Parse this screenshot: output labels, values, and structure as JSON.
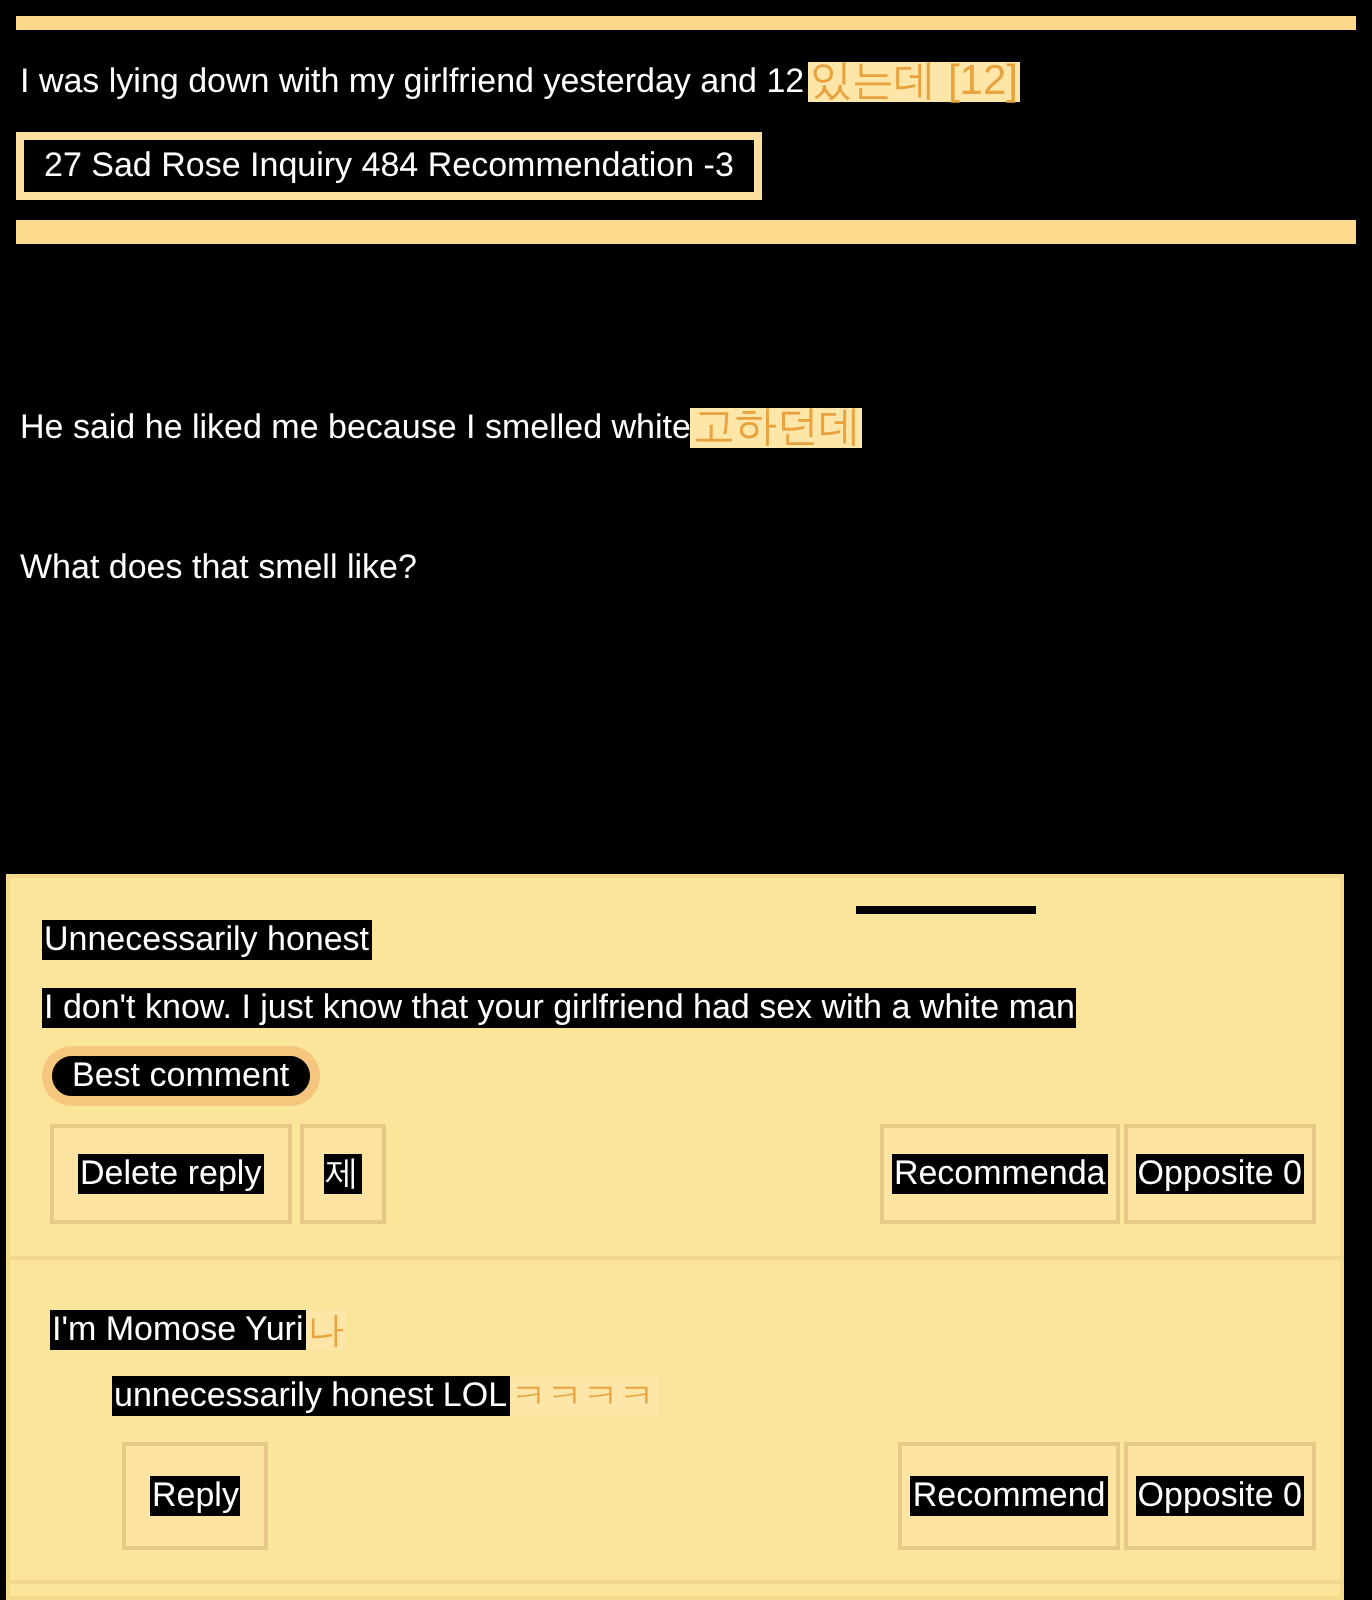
{
  "post": {
    "title": "I was lying down with my girlfriend yesterday and 12",
    "title_trailing": "있는데 [12]",
    "meta": "27 Sad Rose Inquiry 484 Recommendation -3",
    "body": [
      {
        "text": "He said he liked me because I smelled white",
        "trailing": "고하던데"
      },
      {
        "text": "What does that smell like?"
      }
    ]
  },
  "comments": [
    {
      "kind": "comment",
      "author": "Unnecessarily honest",
      "text": "I don't know. I just know that your girlfriend had sex with a white man",
      "badge": "Best comment",
      "actions": [
        "Delete reply",
        "제"
      ],
      "votes": [
        "Recommenda",
        "Opposite 0"
      ]
    },
    {
      "kind": "reply",
      "author": "I'm Momose Yuri",
      "author_trailing": "나",
      "text": "unnecessarily honest LOL",
      "text_trailing": "ㅋㅋㅋㅋ",
      "actions": [
        "Reply"
      ],
      "votes": [
        "Recommend",
        "Opposite 0"
      ]
    }
  ]
}
